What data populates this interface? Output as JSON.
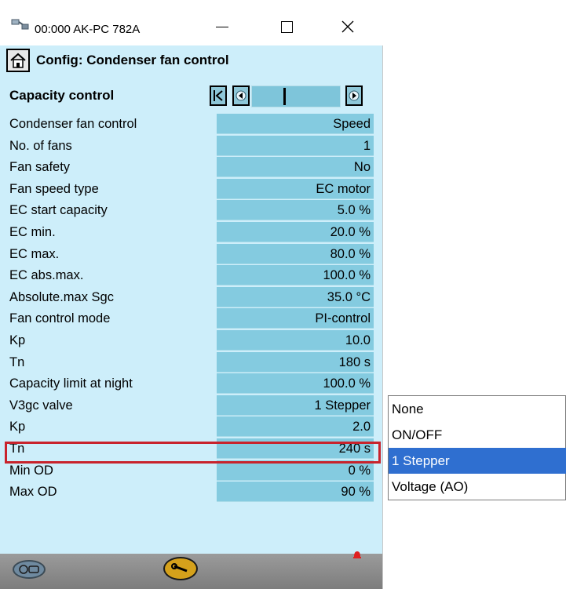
{
  "window": {
    "title": "00:000 AK-PC 782A",
    "min_symbol": "—",
    "max_symbol": "☐",
    "close_symbol": "✕",
    "icon": "connection-icon"
  },
  "header": {
    "title": "Config: Condenser fan control",
    "home_icon": "home-icon"
  },
  "section": {
    "title": "Capacity control",
    "nav_first_icon": "first-page-icon",
    "nav_prev_icon": "previous-page-icon",
    "nav_next_icon": "next-page-icon"
  },
  "rows": [
    {
      "label": "Condenser fan control",
      "value": "Speed"
    },
    {
      "label": "No. of fans",
      "value": "1"
    },
    {
      "label": "Fan safety",
      "value": "No"
    },
    {
      "label": "Fan speed type",
      "value": "EC motor"
    },
    {
      "label": "EC start capacity",
      "value": "5.0 %"
    },
    {
      "label": "EC min.",
      "value": "20.0 %"
    },
    {
      "label": "EC max.",
      "value": "80.0 %"
    },
    {
      "label": "EC abs.max.",
      "value": "100.0 %"
    },
    {
      "label": "Absolute.max Sgc",
      "value": "35.0 °C"
    },
    {
      "label": "Fan control mode",
      "value": "PI-control"
    },
    {
      "label": "Kp",
      "value": "10.0"
    },
    {
      "label": "Tn",
      "value": "180 s"
    },
    {
      "label": "Capacity limit at night",
      "value": "100.0 %"
    },
    {
      "label": "V3gc valve",
      "value": "1 Stepper"
    },
    {
      "label": "Kp",
      "value": "2.0"
    },
    {
      "label": "Tn",
      "value": "240 s"
    },
    {
      "label": "Min OD",
      "value": "0 %"
    },
    {
      "label": "Max OD",
      "value": "90 %"
    }
  ],
  "dropdown": {
    "options": [
      "None",
      "ON/OFF",
      "1 Stepper",
      "Voltage (AO)"
    ],
    "selected": "1 Stepper"
  },
  "footer": {
    "left_icon": "controller-icon",
    "center_icon": "wrench-icon",
    "right_icon": "alarm-bell-icon"
  },
  "colors": {
    "background": "#cdeefa",
    "value_cell": "#84cbe0",
    "highlight_border": "#c8232c",
    "selected_option": "#2f6fd0"
  }
}
